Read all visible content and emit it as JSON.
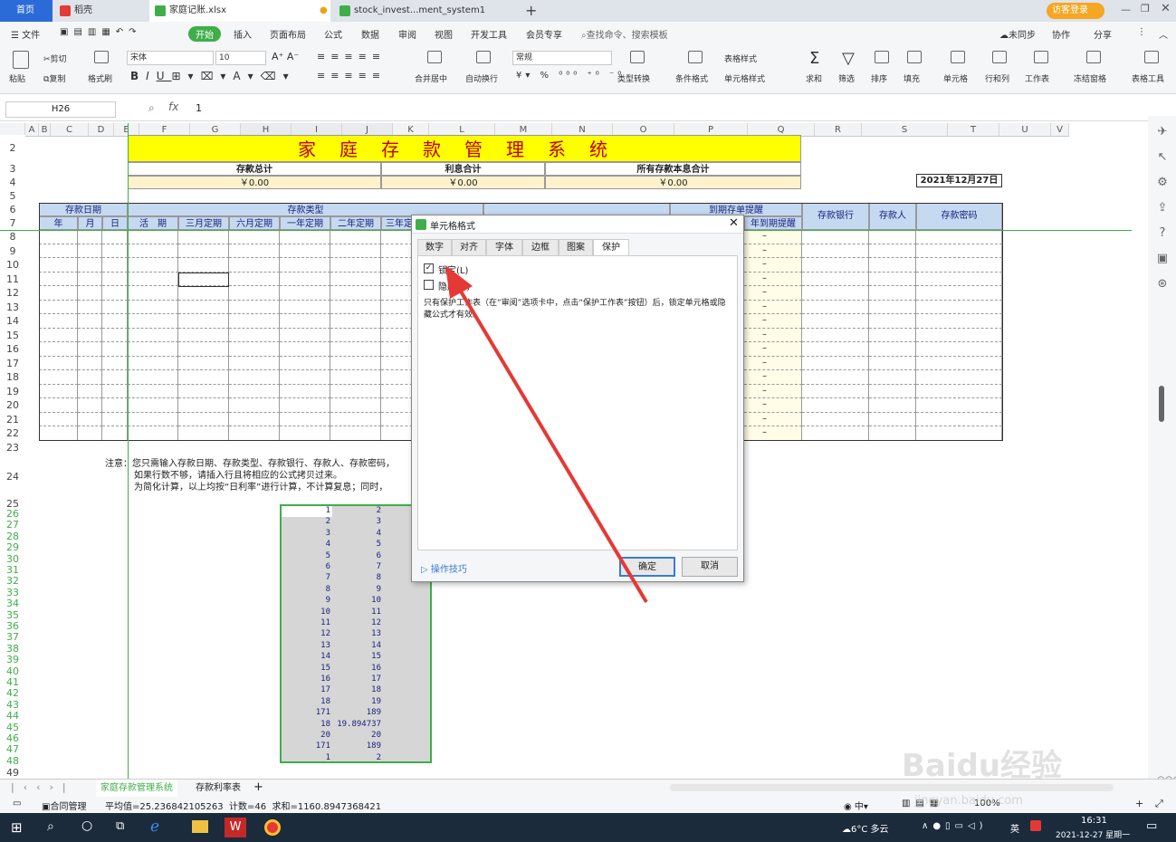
{
  "tabs": {
    "home": "首页",
    "doc1": "稻壳",
    "doc2": "家庭记账.xlsx",
    "doc3": "stock_invest...ment_system1",
    "guest": "访客登录"
  },
  "menu": {
    "file": "文件",
    "start": "开始",
    "insert": "插入",
    "layout": "页面布局",
    "formula": "公式",
    "data": "数据",
    "review": "审阅",
    "view": "视图",
    "dev": "开发工具",
    "member": "会员专享",
    "search": "查找命令、搜索模板",
    "sync": "未同步",
    "collab": "协作",
    "share": "分享"
  },
  "ribbon": {
    "paste": "粘贴",
    "cut": "剪切",
    "copy": "复制",
    "format_painter": "格式刷",
    "font": "宋体",
    "size": "10",
    "merge": "合并居中",
    "wrap": "自动换行",
    "numfmt": "常规",
    "convert": "类型转换",
    "cond": "条件格式",
    "tablestyle": "表格样式",
    "cellstyle": "单元格样式",
    "sum": "求和",
    "filter": "筛选",
    "sort": "排序",
    "fill": "填充",
    "cell": "单元格",
    "rowcol": "行和列",
    "worksheet": "工作表",
    "freeze": "冻结窗格",
    "tools": "表格工具"
  },
  "formula_bar": {
    "namebox": "H26",
    "fx": "fx",
    "value": "1"
  },
  "columns": [
    "A",
    "B",
    "C",
    "D",
    "E",
    "F",
    "G",
    "H",
    "I",
    "J",
    "K",
    "L",
    "M",
    "N",
    "O",
    "P",
    "Q",
    "R",
    "S",
    "T",
    "U",
    "V"
  ],
  "sheet": {
    "title": "家庭存款管理系统",
    "sum_total": "存款总计",
    "sum_interest": "利息合计",
    "sum_all": "所有存款本息合计",
    "val_total": "￥0.00",
    "val_interest": "￥0.00",
    "val_all": "￥0.00",
    "date": "2021年12月27日",
    "h_deposit_date": "存款日期",
    "h_deposit_type": "存款类型",
    "h_expire": "到期存单提醒",
    "h_year": "年",
    "h_month": "月",
    "h_day": "日",
    "h_current": "活　期",
    "h_m3": "三月定期",
    "h_m6": "六月定期",
    "h_y1": "一年定期",
    "h_y2": "二年定期",
    "h_y3": "三年定",
    "h_due": "年到期提醒",
    "h_bank": "存款银行",
    "h_person": "存款人",
    "h_pwd": "存款密码",
    "dash": "–",
    "note1": "注意：您只需输入存款日期、存款类型、存款银行、存款人、存款密码，",
    "note2": "如果行数不够，请插入行且将相应的公式拷贝过来。",
    "note3": "为简化计算，以上均按“日利率”进行计算，不计算复息；同时，"
  },
  "numbers": [
    [
      "1",
      "2"
    ],
    [
      "2",
      "3"
    ],
    [
      "3",
      "4"
    ],
    [
      "4",
      "5"
    ],
    [
      "5",
      "6"
    ],
    [
      "6",
      "7"
    ],
    [
      "7",
      "8"
    ],
    [
      "8",
      "9"
    ],
    [
      "9",
      "10"
    ],
    [
      "10",
      "11"
    ],
    [
      "11",
      "12"
    ],
    [
      "12",
      "13"
    ],
    [
      "13",
      "14"
    ],
    [
      "14",
      "15"
    ],
    [
      "15",
      "16"
    ],
    [
      "16",
      "17"
    ],
    [
      "17",
      "18"
    ],
    [
      "18",
      "19"
    ],
    [
      "171",
      "189"
    ],
    [
      "18",
      "19.894737"
    ],
    [
      "20",
      "20"
    ],
    [
      "171",
      "189"
    ],
    [
      "1",
      "2"
    ]
  ],
  "sheet_tabs": {
    "s1": "家庭存款管理系统",
    "s2": "存款利率表",
    "add": "+"
  },
  "status": {
    "contract": "合同管理",
    "stats": "平均值=25.236842105263  计数=46  求和=1160.8947368421",
    "zoom": "100%"
  },
  "dialog": {
    "title": "单元格格式",
    "tabs": [
      "数字",
      "对齐",
      "字体",
      "边框",
      "图案",
      "保护"
    ],
    "locked": "锁定(L)",
    "hidden": "隐藏(H)",
    "info": "只有保护工作表（在“审阅”选项卡中，点击“保护工作表”按钮）后，锁定单元格或隐藏公式才有效。",
    "tips": "操作技巧",
    "ok": "确定",
    "cancel": "取消"
  },
  "taskbar": {
    "weather": "6°C 多云",
    "ime": "英",
    "time": "16:31",
    "date": "2021-12-27 星期一"
  },
  "watermark": "Baidu经验",
  "watermark_url": "jingyan.baidu.com"
}
